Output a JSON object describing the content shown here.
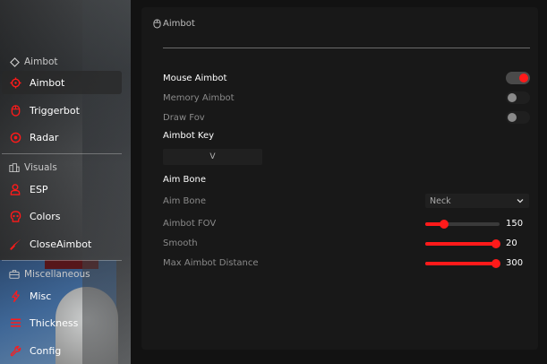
{
  "colors": {
    "accent": "#ff1a1a",
    "panel": "#181818",
    "background": "#121212"
  },
  "window": {
    "title": "Aimbot",
    "title_icon": "mouse-icon"
  },
  "sidebar": {
    "sections": [
      {
        "label": "Aimbot",
        "icon": "diamond-icon"
      },
      {
        "label": "Visuals",
        "icon": "building-icon"
      },
      {
        "label": "Miscellaneous",
        "icon": "toolbox-icon"
      }
    ],
    "items": [
      {
        "label": "Aimbot",
        "icon": "crosshair-icon",
        "active": true
      },
      {
        "label": "Triggerbot",
        "icon": "mouse-icon"
      },
      {
        "label": "Radar",
        "icon": "radar-icon"
      },
      {
        "label": "ESP",
        "icon": "user-icon"
      },
      {
        "label": "Colors",
        "icon": "skull-icon"
      },
      {
        "label": "CloseAimbot",
        "icon": "knife-icon"
      },
      {
        "label": "Misc",
        "icon": "bolt-icon"
      },
      {
        "label": "Thickness",
        "icon": "lines-icon"
      },
      {
        "label": "Config",
        "icon": "wrench-icon"
      }
    ]
  },
  "toggles": [
    {
      "label": "Mouse Aimbot",
      "enabled": true
    },
    {
      "label": "Memory Aimbot",
      "enabled": false
    },
    {
      "label": "Draw Fov",
      "enabled": false
    }
  ],
  "keybind": {
    "heading": "Aimbot Key",
    "value": "V"
  },
  "bone": {
    "heading": "Aim Bone",
    "label": "Aim Bone",
    "selected": "Neck"
  },
  "sliders": [
    {
      "label": "Aimbot FOV",
      "value": "150",
      "level": 0.25
    },
    {
      "label": "Smooth",
      "value": "20",
      "level": 0.95
    },
    {
      "label": "Max Aimbot Distance",
      "value": "300",
      "level": 0.95
    }
  ]
}
